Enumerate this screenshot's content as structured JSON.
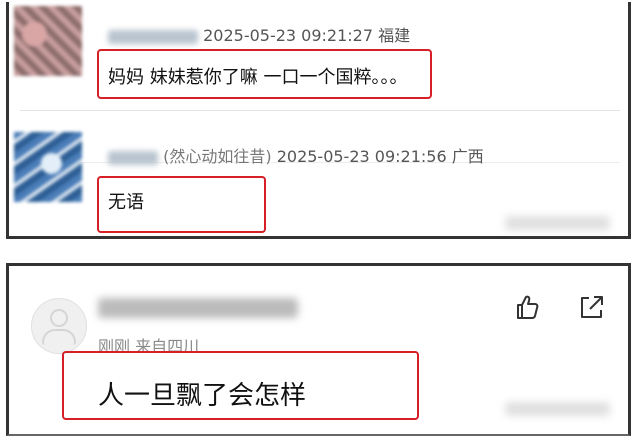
{
  "comments": [
    {
      "timestamp": "2025-05-23 09:21:27",
      "location": "福建",
      "text": "妈妈 妹妹惹你了嘛 一口一个国粹。。。"
    },
    {
      "username_visible": "然心动如往昔",
      "timestamp": "2025-05-23 09:21:56",
      "location": "广西",
      "text": "无语"
    }
  ],
  "bottom_comment": {
    "time_text": "刚刚",
    "origin_text": "来自四川",
    "text": "人一旦飘了会怎样"
  },
  "icons": {
    "like": "thumbs-up-icon",
    "share": "share-icon"
  },
  "colors": {
    "highlight": "#d61f26",
    "panel_border": "#333333"
  }
}
